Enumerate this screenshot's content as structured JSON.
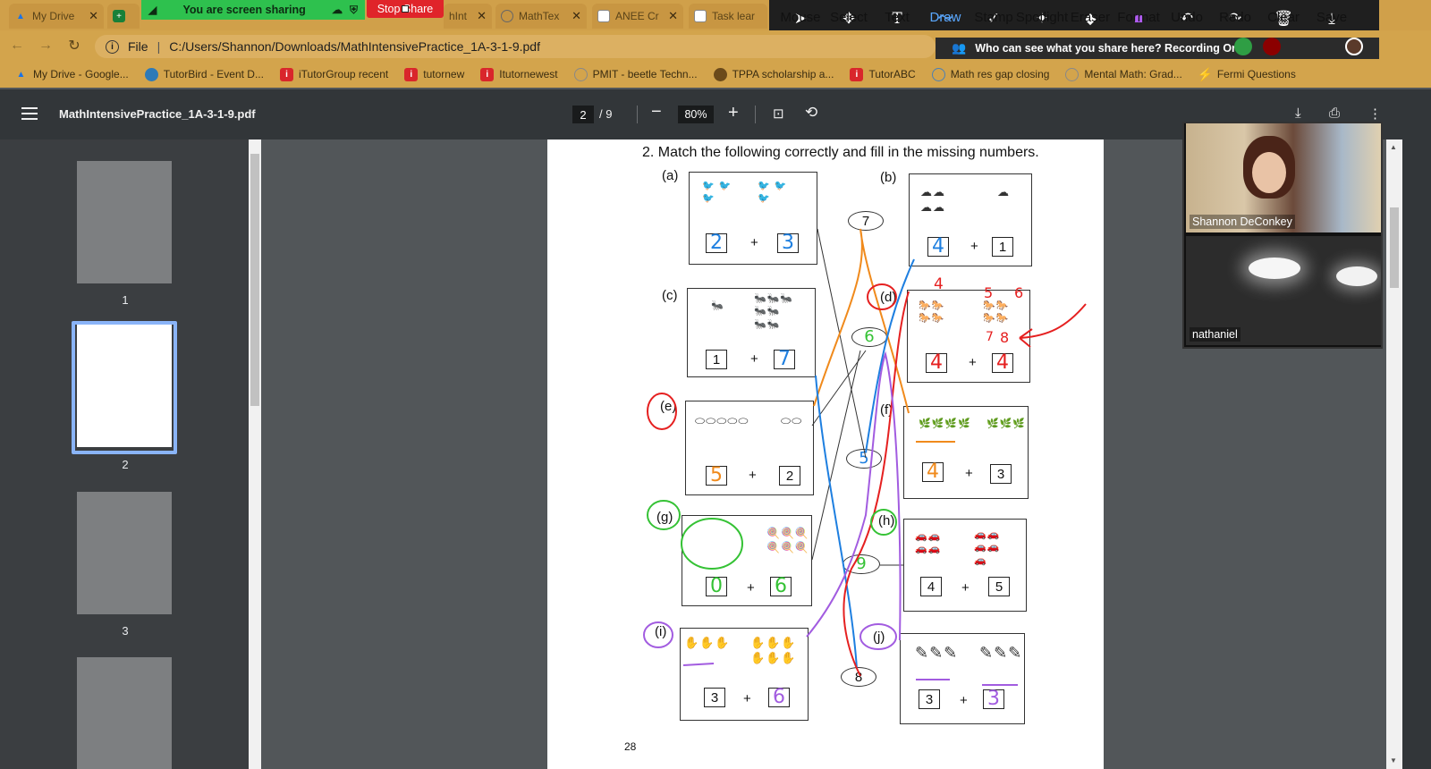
{
  "tabs": [
    {
      "label": "My Drive",
      "icon": "google-drive-icon",
      "color": "#1a73e8"
    },
    {
      "label": "",
      "icon": "google-sheets-icon",
      "color": "#188038"
    },
    {
      "label": "hInt",
      "icon": "pdf-icon",
      "color": "#777"
    },
    {
      "label": "MathTex",
      "icon": "globe-icon",
      "color": "#777"
    },
    {
      "label": "ANEE Cr",
      "icon": "doc-icon",
      "color": "#c89642"
    },
    {
      "label": "Task lear",
      "icon": "doc-icon",
      "color": "#c89642"
    }
  ],
  "share": {
    "status": "You are screen sharing",
    "stop_label": "Stop Share"
  },
  "address": {
    "scheme": "File",
    "url": "C:/Users/Shannon/Downloads/MathIntensivePractice_1A-3-1-9.pdf"
  },
  "bookmarks": [
    {
      "label": "My Drive - Google...",
      "icon": "google-drive-icon",
      "color": "#1a73e8"
    },
    {
      "label": "TutorBird - Event D...",
      "icon": "tutorbird-icon",
      "color": "#2d7ab8"
    },
    {
      "label": "iTutorGroup recent",
      "icon": "itutor-icon",
      "color": "#d9262b"
    },
    {
      "label": "tutornew",
      "icon": "itutor-icon",
      "color": "#d9262b"
    },
    {
      "label": "Itutornewest",
      "icon": "itutor-icon",
      "color": "#d9262b"
    },
    {
      "label": "PMIT - beetle Techn...",
      "icon": "globe-icon",
      "color": "#888"
    },
    {
      "label": "TPPA scholarship a...",
      "icon": "seal-icon",
      "color": "#6b4a1a"
    },
    {
      "label": "TutorABC",
      "icon": "itutor-icon",
      "color": "#d9262b"
    },
    {
      "label": "Math res gap closing",
      "icon": "globe-icon",
      "color": "#4a7fb5"
    },
    {
      "label": "Mental Math: Grad...",
      "icon": "globe-icon",
      "color": "#888"
    },
    {
      "label": "Fermi Questions",
      "icon": "bolt-icon",
      "color": "#e0a020"
    }
  ],
  "annotate_tools": [
    {
      "label": "Mouse",
      "icon": "mouse-pointer-icon",
      "glyph": "➤"
    },
    {
      "label": "Select",
      "icon": "select-move-icon",
      "glyph": "✥"
    },
    {
      "label": "Text",
      "icon": "text-icon",
      "glyph": "T"
    },
    {
      "label": "Draw",
      "icon": "draw-icon",
      "glyph": "〜"
    },
    {
      "label": "Stamp",
      "icon": "stamp-check-icon",
      "glyph": "✓"
    },
    {
      "label": "Spotlight",
      "icon": "spotlight-icon",
      "glyph": "✦"
    },
    {
      "label": "Eraser",
      "icon": "eraser-icon",
      "glyph": "◆"
    },
    {
      "label": "Format",
      "icon": "format-color-icon",
      "glyph": "■"
    },
    {
      "label": "Undo",
      "icon": "undo-icon",
      "glyph": "↶"
    },
    {
      "label": "Redo",
      "icon": "redo-icon",
      "glyph": "↷"
    },
    {
      "label": "Clear",
      "icon": "trash-icon",
      "glyph": "🗑"
    },
    {
      "label": "Save",
      "icon": "save-download-icon",
      "glyph": "⤓"
    }
  ],
  "recording": {
    "text": "Who can see what you share here? Recording On"
  },
  "pdf": {
    "filename": "MathIntensivePractice_1A-3-1-9.pdf",
    "page_current": "2",
    "page_total": "/  9",
    "zoom": "80%",
    "thumbnails": [
      "1",
      "2",
      "3",
      ""
    ]
  },
  "worksheet": {
    "question": "2.  Match the following correctly and fill in the missing numbers.",
    "page_number": "28",
    "ovals": [
      "7",
      "6",
      "5",
      "9",
      "8"
    ],
    "panels": [
      {
        "id": "(a)",
        "pic_left": "🐦 🐦\n🐦",
        "pic_right": "🐦 🐦\n🐦",
        "n1": "2",
        "n2": "3",
        "ink1": "#1e7fe0",
        "ink2": "#1e7fe0"
      },
      {
        "id": "(b)",
        "pic_left": "☁☁\n☁☁",
        "pic_right": "☁",
        "n1": "4",
        "n2": "1",
        "ink1": "#1e7fe0",
        "ink2": ""
      },
      {
        "id": "(c)",
        "pic_left": "🐜",
        "pic_right": "🐜🐜🐜\n🐜🐜\n🐜🐜",
        "n1": "1",
        "n2": "7",
        "ink1": "",
        "ink2": "#1e7fe0"
      },
      {
        "id": "(d)",
        "pic_left": "🐎🐎\n🐎🐎",
        "pic_right": "🐎🐎\n🐎🐎",
        "n1": "4",
        "n2": "4",
        "ink1": "#e52020",
        "ink2": "#e52020"
      },
      {
        "id": "(e)",
        "pic_left": "⬭⬭⬭⬭⬭",
        "pic_right": "⬭⬭",
        "n1": "5",
        "n2": "2",
        "ink1": "#f08a1c",
        "ink2": ""
      },
      {
        "id": "(f)",
        "pic_left": "🌿🌿🌿🌿",
        "pic_right": "🌿🌿🌿",
        "n1": "4",
        "n2": "3",
        "ink1": "#f08a1c",
        "ink2": ""
      },
      {
        "id": "(g)",
        "pic_left": "",
        "pic_right": "🍭🍭🍭\n🍭🍭🍭",
        "n1": "0",
        "n2": "6",
        "ink1": "#35c235",
        "ink2": "#35c235"
      },
      {
        "id": "(h)",
        "pic_left": "🚗🚗\n🚗🚗",
        "pic_right": "🚗🚗\n🚗🚗\n🚗",
        "n1": "4",
        "n2": "5",
        "ink1": "",
        "ink2": ""
      },
      {
        "id": "(i)",
        "pic_left": "✋✋✋",
        "pic_right": "✋✋✋\n✋✋✋",
        "n1": "3",
        "n2": "6",
        "ink1": "",
        "ink2": "#a25ce0"
      },
      {
        "id": "(j)",
        "pic_left": "✎✎✎",
        "pic_right": "✎✎✎",
        "n1": "3",
        "n2": "3",
        "ink1": "",
        "ink2": "#a25ce0"
      }
    ],
    "d_counts": [
      "4",
      "5",
      "6",
      "7",
      "8"
    ]
  },
  "participants": [
    {
      "name": "Shannon DeConkey"
    },
    {
      "name": "nathaniel"
    }
  ],
  "colors": {
    "ink_blue": "#1e7fe0",
    "ink_orange": "#f08a1c",
    "ink_red": "#e52020",
    "ink_green": "#35c235",
    "ink_purple": "#a25ce0"
  }
}
